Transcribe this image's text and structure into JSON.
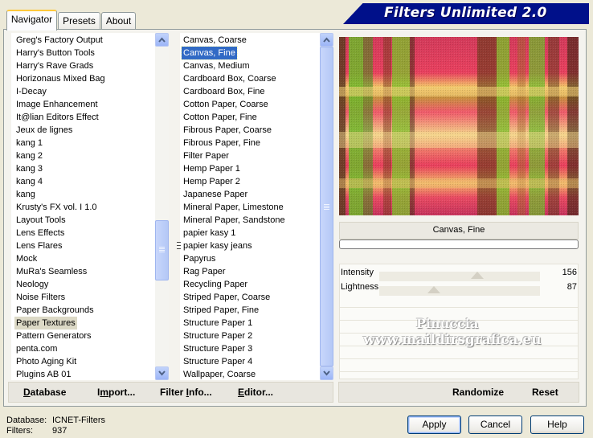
{
  "tabs": [
    "Navigator",
    "Presets",
    "About"
  ],
  "banner": "Filters Unlimited 2.0",
  "categories": [
    "Greg's Factory Output",
    "Harry's Button Tools",
    "Harry's Rave Grads",
    "Horizonaus Mixed Bag",
    "I-Decay",
    "Image Enhancement",
    "It@lian Editors Effect",
    "Jeux de lignes",
    "kang 1",
    "kang 2",
    "kang 3",
    "kang 4",
    "kang",
    "Krusty's FX vol. I 1.0",
    "Layout Tools",
    "Lens Effects",
    "Lens Flares",
    "Mock",
    "MuRa's Seamless",
    "Neology",
    "Noise Filters",
    "Paper Backgrounds",
    "Paper Textures",
    "Pattern Generators",
    "penta.com",
    "Photo Aging Kit",
    "Plugins AB 01"
  ],
  "selected_category": "Paper Textures",
  "filters": [
    "Canvas, Coarse",
    "Canvas, Fine",
    "Canvas, Medium",
    "Cardboard Box, Coarse",
    "Cardboard Box, Fine",
    "Cotton Paper, Coarse",
    "Cotton Paper, Fine",
    "Fibrous Paper, Coarse",
    "Fibrous Paper, Fine",
    "Filter Paper",
    "Hemp Paper 1",
    "Hemp Paper 2",
    "Japanese Paper",
    "Mineral Paper, Limestone",
    "Mineral Paper, Sandstone",
    "papier kasy 1",
    "papier kasy jeans",
    "Papyrus",
    "Rag Paper",
    "Recycling Paper",
    "Striped Paper, Coarse",
    "Striped Paper, Fine",
    "Structure Paper 1",
    "Structure Paper 2",
    "Structure Paper 3",
    "Structure Paper 4",
    "Wallpaper, Coarse"
  ],
  "selected_filter": "Canvas, Fine",
  "filter_name": "Canvas, Fine",
  "params": [
    {
      "label": "Intensity",
      "value": "156",
      "level": 0.61
    },
    {
      "label": "Lightness",
      "value": "87",
      "level": 0.34
    }
  ],
  "watermark": {
    "line1": "Pinuccia",
    "line2": "www.maildirsgrafica.eu"
  },
  "toolbar": {
    "database": {
      "u": "D",
      "rest": "atabase"
    },
    "import": {
      "pre": "I",
      "u": "m",
      "rest": "port..."
    },
    "filter_info": {
      "pre": "Filter ",
      "u": "I",
      "rest": "nfo..."
    },
    "editor": {
      "u": "E",
      "rest": "ditor..."
    },
    "randomize": "Randomize",
    "reset": "Reset"
  },
  "status": {
    "database_label": "Database:",
    "database_value": "ICNET-Filters",
    "filters_label": "Filters:",
    "filters_value": "937"
  },
  "buttons": {
    "apply": "Apply",
    "cancel": "Cancel",
    "help": "Help"
  },
  "colors": {
    "highlight": "#316ac5",
    "banner": "#00108a",
    "tab_accent": "#ffc83c"
  }
}
